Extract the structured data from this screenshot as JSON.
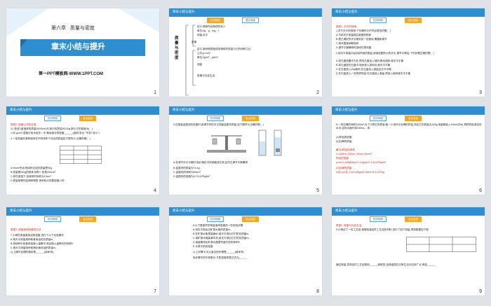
{
  "slides": [
    {
      "num": "1",
      "chapter": "第六章   质量与密度",
      "title": "章末小结与提升",
      "footer": "第一PPT模板网-WWW.1PPT.COM"
    },
    {
      "num": "2",
      "bar": "章末小结与提升",
      "tabs": [
        "知识网络",
        "重点突破"
      ],
      "center": "质量与密度",
      "lines": [
        "定义:物体所含物质的多少",
        "单位:kg、g、mg、t",
        "测量:天平",
        "密度",
        "定义:某种物质组成的物体的质量与它的体积之比",
        "公式:ρ=m/V",
        "单位:kg/m³、g/cm³",
        "测量",
        "密度与社会生活"
      ]
    },
    {
      "num": "3",
      "bar": "章末小结与提升",
      "tabs": [
        "知识网络",
        "重点突破"
      ],
      "lines": [
        "类型1  天平的使用",
        "1.关于天平的使用,下列操作中不符合规范的是(   )",
        "A.不用天平测量超过量程的物体",
        "B.把已调好的天平移到另一处使用,需重新调节",
        "C.用手直接拿取砝码",
        "D.调节平衡螺母时游码在零刻度",
        "2.用天平测量20g实验所用的食盐,使用如图所示的天平,调节平衡后,下列步骤正确的是(   )",
        "A.将左盘放置天平处,再向右盘加入砝码,移动游码,使天平平衡",
        "B.将左盘放在右盘中,砝码放入游码处,使天平平衡",
        "C.在右盘放入20g砝码,在左盘加入食盐至天平平衡",
        "D.在右盘放入一张同样的纸,在左盘放入食盐,再放入砝码使天平平衡"
      ]
    },
    {
      "num": "4",
      "bar": "章末小结与提升",
      "tabs": [
        "知识网络",
        "重点突破"
      ],
      "lines": [
        "类型2  密度公式的应用",
        "3.(“多选”)某液体的质量为200mL时,其中的质量为210g,那么它的密度为(   )",
        "1.05 g/cm³;若瓶中的水用去一半,剩余部分的密度______(选填“变大”“不变”“变小”)",
        "4.一定质量的某种液体在不同体积下对应的质量如下表所示,正确的是(   )",
        "A.90cm³的水的体积对应的质量是90g",
        "B.质量是200g的物体,体积一定是200cm³",
        "C.若在室温下,该液体的体积为10cm³",
        "D.质量相等的这两种物质,体积较大的是密度小的"
      ]
    },
    {
      "num": "5",
      "bar": "章末小结与提升",
      "tabs": [
        "知识网络",
        "重点突破"
      ],
      "lines": [
        "5.在测量金属块的密度时,用调节好的天平测量金属块质量,如下图所示正确的是(   )",
        "A.在调节天平平衡时,指针指在中央刻度线左侧,应向左调节平衡螺母",
        "B.金属块的质量为74.4g",
        "C.金属块的体积为60cm³",
        "D.金属块的密度为3.72×10³kg/m³"
      ]
    },
    {
      "num": "6",
      "bar": "章末小结与提升",
      "tabs": [
        "知识网络",
        "重点突破"
      ],
      "lines": [
        "6.一块石碑的体积为30m³,为了计算它的质量,取一小块作为石碑的样品,测出它的质量为140g,用量筒装入100mL的水,再把样品浸没在水中,这时水面升到150mL。求:",
        "(1)样品的密度;",
        "(2)石碑的质量。"
      ],
      "answer": [
        "解:(1)样品的体积",
        "V=150mL-100mL=50mL=50cm³",
        "样品的密度",
        "ρ=m/V=140g/50cm³=2.8g/cm³=2.8×10³kg/m³",
        "(2)石碑的质量",
        "m总=ρV总=2.8×10³kg/m³×30m³=8.4×10⁴kg"
      ]
    },
    {
      "num": "7",
      "bar": "章末小结与提升",
      "tabs": [
        "知识网络",
        "重点突破"
      ],
      "lines": [
        "类型3  测量液体密度的方法",
        "7.小明在测量食用油的密度,进行了以下实验操作:",
        "A.用天平测量烧杯和食用油的总质量m₁",
        "B.将烧杯中的食用油倒入量筒中,测出倒入量筒中的体积V",
        "C.用天平测量烧杯和剩余食用油的质量m₂",
        "以上操作合理的顺序是______(填序号)。"
      ]
    },
    {
      "num": "8",
      "bar": "章末小结与提升",
      "tabs": [
        "知识网络",
        "重点突破"
      ],
      "lines": [
        "8.以下是某同学测量液体密度的一些实验步骤:",
        "A.用天平测出空矿泉水瓶的质量m₀",
        "B.在矿泉水瓶里装满水,用天平测出它们的总质量m₁",
        "C.用矿泉水瓶装满牛奶,用天平测出它们的总质量m₂",
        "D.用量筒测出矿泉水瓶里所盛牛奶的体积V",
        "E.计算牛奶的密度",
        "以上步骤中,可以省去的步骤是______(填序号)",
        "用步骤中的字母表示,牛奶密度的表达式为______"
      ]
    },
    {
      "num": "9",
      "bar": "章末小结与提升",
      "tabs": [
        "知识网络",
        "重点突破"
      ],
      "lines": [
        "类型4  密度与社会生活",
        "9.小明买了一件工艺品,他想知道这件工艺品的材料,进行了如下测量,得到数据如下表:",
        "通过测量,发现这件工艺品是用______制成的,这种金属在日常生活中应用广泛,例如______"
      ]
    }
  ],
  "colors": {
    "accent": "#2e8fd0",
    "tab_active": "#f6a623",
    "answer": "#d62020"
  }
}
